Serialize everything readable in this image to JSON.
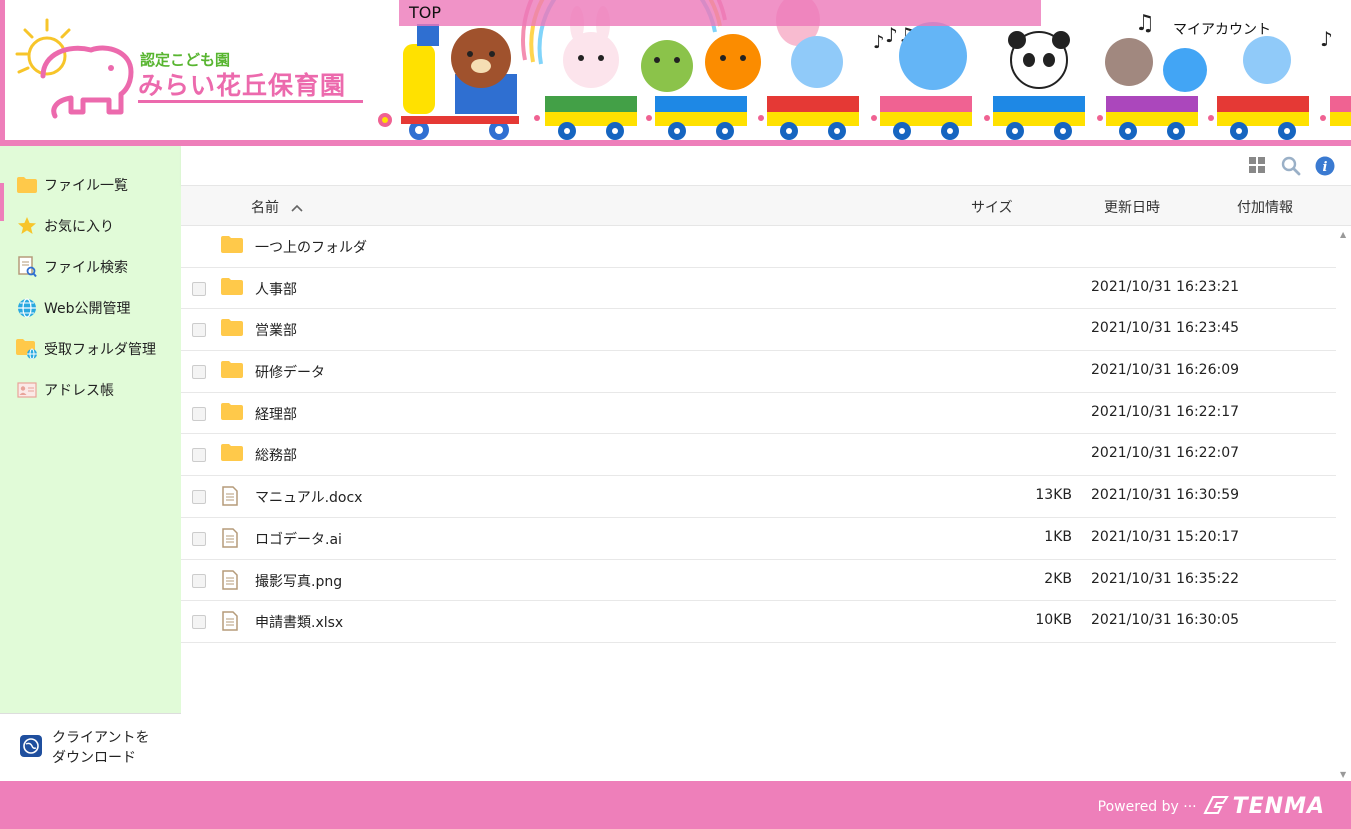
{
  "header": {
    "logo_sub": "認定こども園",
    "logo_main": "みらい花丘保育園",
    "top_link": "TOP",
    "account_link": "マイアカウント"
  },
  "sidebar": {
    "items": [
      {
        "label": "ファイル一覧",
        "icon": "folder-icon"
      },
      {
        "label": "お気に入り",
        "icon": "star-icon"
      },
      {
        "label": "ファイル検索",
        "icon": "file-search-icon"
      },
      {
        "label": "Web公開管理",
        "icon": "globe-icon"
      },
      {
        "label": "受取フォルダ管理",
        "icon": "folder-globe-icon"
      },
      {
        "label": "アドレス帳",
        "icon": "address-card-icon"
      }
    ],
    "client_download": {
      "line1": "クライアントを",
      "line2": "ダウンロード"
    }
  },
  "table": {
    "columns": {
      "name": "名前",
      "size": "サイズ",
      "modified": "更新日時",
      "info": "付加情報"
    },
    "parent_folder": "一つ上のフォルダ",
    "rows": [
      {
        "name": "人事部",
        "type": "folder",
        "size": "",
        "modified": "2021/10/31 16:23:21"
      },
      {
        "name": "営業部",
        "type": "folder",
        "size": "",
        "modified": "2021/10/31 16:23:45"
      },
      {
        "name": "研修データ",
        "type": "folder",
        "size": "",
        "modified": "2021/10/31 16:26:09"
      },
      {
        "name": "経理部",
        "type": "folder",
        "size": "",
        "modified": "2021/10/31 16:22:17"
      },
      {
        "name": "総務部",
        "type": "folder",
        "size": "",
        "modified": "2021/10/31 16:22:07"
      },
      {
        "name": "マニュアル.docx",
        "type": "file",
        "size": "13KB",
        "modified": "2021/10/31 16:30:59"
      },
      {
        "name": "ロゴデータ.ai",
        "type": "file",
        "size": "1KB",
        "modified": "2021/10/31 15:20:17"
      },
      {
        "name": "撮影写真.png",
        "type": "file",
        "size": "2KB",
        "modified": "2021/10/31 16:35:22"
      },
      {
        "name": "申請書類.xlsx",
        "type": "file",
        "size": "10KB",
        "modified": "2021/10/31 16:30:05"
      }
    ]
  },
  "footer": {
    "powered_by": "Powered by ···",
    "brand": "TENMA"
  },
  "colors": {
    "accent_pink": "#ee7fba",
    "sidebar_bg": "#e1fbd8",
    "folder_yellow": "#ffc94a"
  }
}
